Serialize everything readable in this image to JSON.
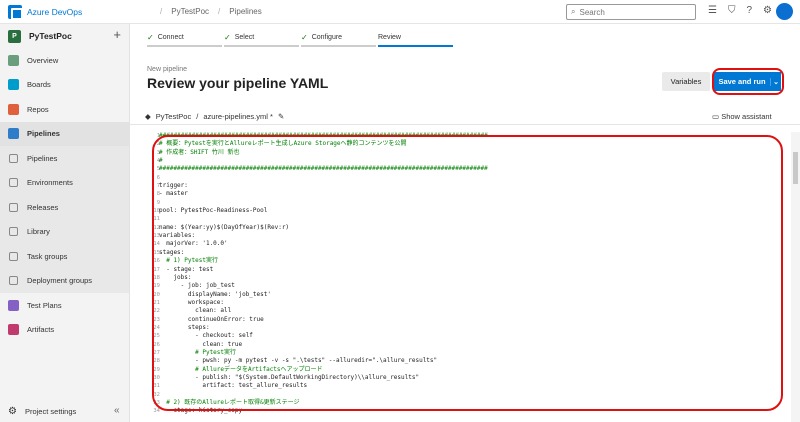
{
  "topbar": {
    "brand": "Azure DevOps",
    "crumbs": [
      "PyTestPoc",
      "Pipelines"
    ],
    "search_placeholder": "Search"
  },
  "sidebar": {
    "project_initial": "P",
    "project_name": "PyTestPoc",
    "add_label": "+",
    "items": [
      {
        "label": "Overview",
        "icon": "overview-icon",
        "color": "#6b9e7c"
      },
      {
        "label": "Boards",
        "icon": "boards-icon",
        "color": "#009ccc"
      },
      {
        "label": "Repos",
        "icon": "repos-icon",
        "color": "#e05f3c"
      },
      {
        "label": "Pipelines",
        "icon": "pipelines-icon",
        "color": "#2f7cc9"
      },
      {
        "label": "Pipelines",
        "icon": "pipelines-sub-icon",
        "color": "#2f7cc9"
      },
      {
        "label": "Environments",
        "icon": "environments-icon",
        "color": "#777"
      },
      {
        "label": "Releases",
        "icon": "releases-icon",
        "color": "#777"
      },
      {
        "label": "Library",
        "icon": "library-icon",
        "color": "#777"
      },
      {
        "label": "Task groups",
        "icon": "task-groups-icon",
        "color": "#777"
      },
      {
        "label": "Deployment groups",
        "icon": "deployment-groups-icon",
        "color": "#777"
      },
      {
        "label": "Test Plans",
        "icon": "test-plans-icon",
        "color": "#8661c5"
      },
      {
        "label": "Artifacts",
        "icon": "artifacts-icon",
        "color": "#c03a6e"
      }
    ],
    "settings_label": "Project settings"
  },
  "wizard": {
    "steps": [
      "Connect",
      "Select",
      "Configure",
      "Review"
    ]
  },
  "page": {
    "subtitle": "New pipeline",
    "title": "Review your pipeline YAML",
    "variables_label": "Variables",
    "save_label": "Save and run"
  },
  "file": {
    "repo": "PyTestPoc",
    "sep": "/",
    "path": "azure-pipelines.yml *",
    "show_assistant": "Show assistant"
  },
  "editor": {
    "lines": [
      "1",
      "2",
      "3",
      "4",
      "5",
      "6",
      "7",
      "8",
      "9",
      "10",
      "11",
      "12",
      "13",
      "14",
      "15",
      "16",
      "17",
      "18",
      "19",
      "20",
      "21",
      "22",
      "23",
      "24",
      "25",
      "26",
      "27",
      "28",
      "29",
      "30",
      "31",
      "32",
      "33",
      "34"
    ],
    "code": [
      "###########################################################################################",
      "# 概要：Pytestを実行とAllureレポート生成しAzure Storageへ静的コンテンツを公開",
      "# 作成者：SHIFT 竹川 新也",
      "#",
      "###########################################################################################",
      "",
      "trigger:",
      "- master",
      "",
      "pool: PytestPoc-Readiness-Pool",
      "",
      "name: $(Year:yy)$(DayOfYear)$(Rev:r)",
      "variables:",
      "  majorVer: '1.0.0'",
      "stages:",
      "  # 1) Pytest実行",
      "  - stage: test",
      "    jobs:",
      "      - job: job_test",
      "        displayName: 'job_test'",
      "        workspace:",
      "          clean: all",
      "        continueOnError: true",
      "        steps:",
      "          - checkout: self",
      "            clean: true",
      "          # Pytest実行",
      "          - pwsh: py -m pytest -v -s \".\\tests\" --alluredir=\".\\allure_results\"",
      "          # AllureデータをArtifactsへアップロード",
      "          - publish: \"$(System.DefaultWorkingDirectory)\\\\allure_results\"",
      "            artifact: test_allure_results",
      "",
      "  # 2) 既存のAllureレポート取得&更新ステージ",
      "  - stage: history_copy"
    ]
  }
}
